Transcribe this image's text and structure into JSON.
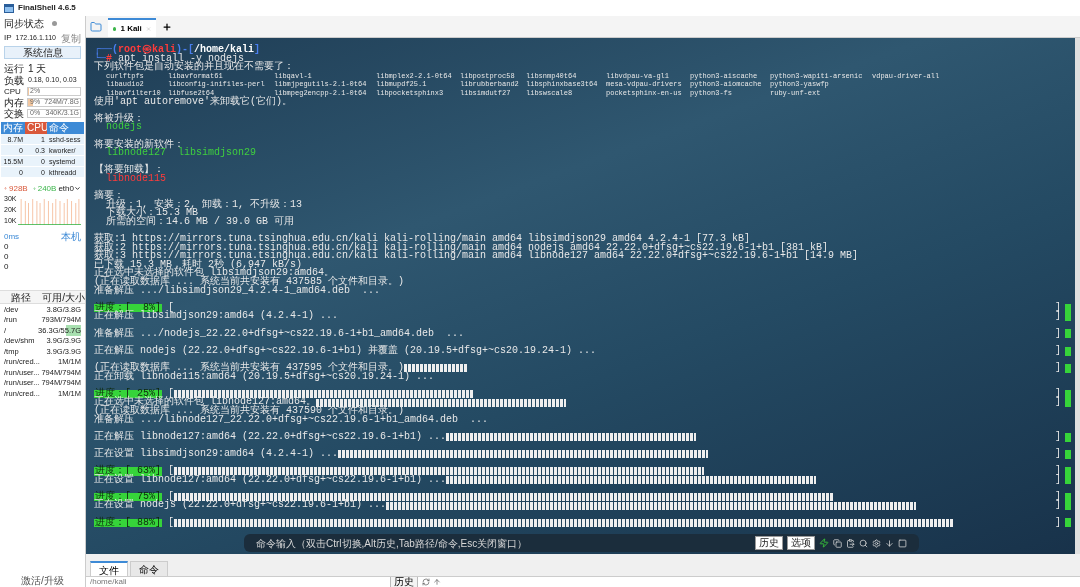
{
  "window": {
    "title": "FinalShell 4.6.5"
  },
  "sidebar": {
    "sync": {
      "label": "同步状态",
      "online": false
    },
    "ip": {
      "label": "IP",
      "value": "172.16.1.110",
      "action": "复制"
    },
    "sysinfo_button": "系统信息",
    "uptime": {
      "label": "运行",
      "value": "1 天"
    },
    "load": {
      "label": "负载",
      "value": "0.18, 0.10, 0.03"
    },
    "meters": [
      {
        "label": "CPU",
        "level": 0.02,
        "reading": "2%"
      },
      {
        "label": "内存",
        "level": 0.09,
        "reading": "9%",
        "detail": "724M/7.8G"
      },
      {
        "label": "交换",
        "reading": "0%",
        "detail": "340K/3.1G"
      }
    ],
    "processes": {
      "columns": [
        {
          "label": "内存",
          "selected": false
        },
        {
          "label": "CPU",
          "selected": true
        },
        {
          "label": "命令",
          "selected": false
        }
      ],
      "rows": [
        [
          "8.7M",
          "1",
          "sshd-sess"
        ],
        [
          "0",
          "0.3",
          "kworker/"
        ],
        [
          "15.5M",
          "0",
          "systemd"
        ],
        [
          "0",
          "0",
          "kthreadd"
        ]
      ]
    },
    "network": {
      "up": "928B",
      "down": "240B",
      "interface": "eth0",
      "yticks": [
        "30K",
        "20K",
        "10K"
      ]
    },
    "ping": {
      "latency": "0ms",
      "host": "本机",
      "values": [
        "0",
        "0",
        "0"
      ]
    },
    "disks": {
      "columns": [
        "路径",
        "可用/大小"
      ],
      "rows": [
        {
          "path": "/dev",
          "usage": "3.8G/3.8G"
        },
        {
          "path": "/run",
          "usage": "793M/794M"
        },
        {
          "path": "/",
          "usage": "36.3G/55.7G",
          "level": 0.35
        },
        {
          "path": "/dev/shm",
          "usage": "3.9G/3.9G"
        },
        {
          "path": "/tmp",
          "usage": "3.9G/3.9G"
        },
        {
          "path": "/run/cred...",
          "usage": "1M/1M"
        },
        {
          "path": "/run/user...",
          "usage": "794M/794M"
        },
        {
          "path": "/run/user...",
          "usage": "794M/794M"
        },
        {
          "path": "/run/cred...",
          "usage": "1M/1M"
        }
      ]
    },
    "upgrade_link": "激活/升级"
  },
  "tabs": [
    {
      "label": "1 Kali",
      "selected": true,
      "connected": true
    }
  ],
  "terminal": {
    "lines": [
      {
        "kind": "text",
        "segments": [
          {
            "text": "┌──(",
            "kind": "frame"
          },
          {
            "text": "root㉿kali",
            "kind": "user"
          },
          {
            "text": ")-[",
            "kind": "frame"
          },
          {
            "text": "/home/kali",
            "kind": "path"
          },
          {
            "text": "]",
            "kind": "frame"
          }
        ]
      },
      {
        "kind": "text",
        "segments": [
          {
            "text": "└─",
            "kind": "frame"
          },
          {
            "text": "#",
            "kind": "user"
          },
          {
            "text": " apt install -y nodejs",
            "kind": "plain"
          }
        ]
      },
      {
        "kind": "text",
        "segments": [
          {
            "text": "下列软件包是自动安装的并且现在不需要了：",
            "kind": "plain"
          }
        ]
      },
      {
        "kind": "packages",
        "cells": [
          "curlftpfs",
          "libavformat61",
          "libqavl-1",
          "libmplex2-2.1-0t64",
          "libpostproc58",
          "libsnmp40t64",
          "libvdpau-va-gl1",
          "python3-aiscache",
          "python3-wapiti-arsenic",
          "vdpau-driver-all"
        ]
      },
      {
        "kind": "packages",
        "cells": [
          "libaudio2",
          "libconfig-inifiles-perl",
          "libmjpegutils-2.1-0t64",
          "libmupdf25.1",
          "librubberband2",
          "libsphinxbase3t64",
          "mesa-vdpau-drivers",
          "python3-aiomcache",
          "python3-yaswfp"
        ]
      },
      {
        "kind": "packages",
        "cells": [
          "libavfilter10",
          "libfuse2t64",
          "libmpeg2encpp-2.1-0t64",
          "libpocketsphinx3",
          "libsimdutf27",
          "libswscale8",
          "pocketsphinx-en-us",
          "python3-fs",
          "ruby-unf-ext"
        ]
      },
      {
        "kind": "text",
        "segments": [
          {
            "text": "使用'apt autoremove'来卸载它(它们)。",
            "kind": "plain"
          }
        ]
      },
      {
        "kind": "blank"
      },
      {
        "kind": "text",
        "segments": [
          {
            "text": "将被升级：",
            "kind": "plain"
          }
        ]
      },
      {
        "kind": "text",
        "segments": [
          {
            "text": "  nodejs",
            "kind": "added"
          }
        ]
      },
      {
        "kind": "blank"
      },
      {
        "kind": "text",
        "segments": [
          {
            "text": "将要安装的新软件：",
            "kind": "plain"
          }
        ]
      },
      {
        "kind": "text",
        "segments": [
          {
            "text": "  libnode127  libsimdjson29",
            "kind": "added"
          }
        ]
      },
      {
        "kind": "blank"
      },
      {
        "kind": "text",
        "segments": [
          {
            "text": "【将要卸载】：",
            "kind": "plain"
          }
        ]
      },
      {
        "kind": "text",
        "segments": [
          {
            "text": "  libnode115",
            "kind": "removed"
          }
        ]
      },
      {
        "kind": "blank"
      },
      {
        "kind": "text",
        "segments": [
          {
            "text": "摘要：",
            "kind": "plain"
          }
        ]
      },
      {
        "kind": "text",
        "segments": [
          {
            "text": "  升级：1, 安装：2, 卸载：1, 不升级：13",
            "kind": "plain"
          }
        ]
      },
      {
        "kind": "text",
        "segments": [
          {
            "text": "  下载大小：15.3 MB",
            "kind": "plain"
          }
        ]
      },
      {
        "kind": "text",
        "segments": [
          {
            "text": "  所需的空间：14.6 MB / 39.0 GB 可用",
            "kind": "plain"
          }
        ]
      },
      {
        "kind": "blank"
      },
      {
        "kind": "text",
        "segments": [
          {
            "text": "获取:1 https://mirrors.tuna.tsinghua.edu.cn/kali kali-rolling/main amd64 libsimdjson29 amd64 4.2.4-1 [77.3 kB]",
            "kind": "plain"
          }
        ]
      },
      {
        "kind": "text",
        "segments": [
          {
            "text": "获取:2 https://mirrors.tuna.tsinghua.edu.cn/kali kali-rolling/main amd64 nodejs amd64 22.22.0+dfsg+~cs22.19.6-1+b1 [381 kB]",
            "kind": "plain"
          }
        ]
      },
      {
        "kind": "text",
        "segments": [
          {
            "text": "获取:3 https://mirrors.tuna.tsinghua.edu.cn/kali kali-rolling/main amd64 libnode127 amd64 22.22.0+dfsg+~cs22.19.6-1+b1 [14.9 MB]",
            "kind": "plain"
          }
        ]
      },
      {
        "kind": "text",
        "segments": [
          {
            "text": "已下载 15.3 MB，耗时 2秒 (6,947 kB/s)",
            "kind": "plain"
          }
        ]
      },
      {
        "kind": "text",
        "segments": [
          {
            "text": "正在选中未选择的软件包 libsimdjson29:amd64。",
            "kind": "plain"
          }
        ]
      },
      {
        "kind": "text",
        "segments": [
          {
            "text": "(正在读取数据库 ... 系统当前共安装有 437585 个文件和目录。)",
            "kind": "plain"
          }
        ]
      },
      {
        "kind": "text",
        "segments": [
          {
            "text": "准备解压 .../libsimdjson29_4.2.4-1_amd64.deb  ...",
            "kind": "plain"
          }
        ]
      },
      {
        "kind": "blank"
      },
      {
        "kind": "text",
        "segments": [
          {
            "text": "进度：[  8%]",
            "kind": "badge"
          },
          {
            "text": " [",
            "kind": "plain"
          }
        ],
        "tail": "]"
      },
      {
        "kind": "text",
        "segments": [
          {
            "text": "正在解压 libsimdjson29:amd64 (4.2.4-1) ...",
            "kind": "plain"
          }
        ],
        "tail": "]"
      },
      {
        "kind": "blank"
      },
      {
        "kind": "text",
        "segments": [
          {
            "text": "准备解压 .../nodejs_22.22.0+dfsg+~cs22.19.6-1+b1_amd64.deb  ...",
            "kind": "plain"
          }
        ],
        "tail": "]"
      },
      {
        "kind": "blank"
      },
      {
        "kind": "text",
        "segments": [
          {
            "text": "正在解压 nodejs (22.22.0+dfsg+~cs22.19.6-1+b1) 并覆盖 (20.19.5+dfsg+~cs20.19.24-1) ...",
            "kind": "plain"
          }
        ],
        "tail": "]"
      },
      {
        "kind": "blank"
      },
      {
        "kind": "text",
        "segments": [
          {
            "text": "(正在读取数据库 ... 系统当前共安装有 437595 个文件和目录。)",
            "kind": "plain"
          },
          {
            "kind": "tiny"
          }
        ],
        "tail": "]"
      },
      {
        "kind": "text",
        "segments": [
          {
            "text": "正在卸载 libnode115:amd64 (20.19.5+dfsg+~cs20.19.24-1) ...",
            "kind": "plain"
          }
        ]
      },
      {
        "kind": "blank"
      },
      {
        "kind": "text",
        "segments": [
          {
            "text": "进度：[ 25%]",
            "kind": "badge"
          },
          {
            "text": " [",
            "kind": "plain"
          },
          {
            "kind": "medium"
          }
        ],
        "tail": "]"
      },
      {
        "kind": "text",
        "segments": [
          {
            "text": "正在选中未选择的软件包 libnode127:amd64。",
            "kind": "plain"
          },
          {
            "kind": "short"
          }
        ],
        "tail": "]"
      },
      {
        "kind": "text",
        "segments": [
          {
            "text": "(正在读取数据库 ... 系统当前共安装有 437590 个文件和目录。)",
            "kind": "plain"
          }
        ]
      },
      {
        "kind": "text",
        "segments": [
          {
            "text": "准备解压 .../libnode127_22.22.0+dfsg+~cs22.19.6-1+b1_amd64.deb  ...",
            "kind": "plain"
          }
        ]
      },
      {
        "kind": "blank"
      },
      {
        "kind": "text",
        "segments": [
          {
            "text": "正在解压 libnode127:amd64 (22.22.0+dfsg+~cs22.19.6-1+b1) ...",
            "kind": "plain"
          },
          {
            "kind": "short"
          }
        ],
        "tail": "]"
      },
      {
        "kind": "blank"
      },
      {
        "kind": "text",
        "segments": [
          {
            "text": "正在设置 libsimdjson29:amd64 (4.2.4-1) ...",
            "kind": "plain"
          },
          {
            "kind": "long"
          }
        ],
        "tail": "]"
      },
      {
        "kind": "blank"
      },
      {
        "kind": "text",
        "segments": [
          {
            "text": "进度：[ 63%]",
            "kind": "badge"
          },
          {
            "text": " [",
            "kind": "plain"
          },
          {
            "kind": "wide"
          }
        ],
        "tail": "]"
      },
      {
        "kind": "text",
        "segments": [
          {
            "text": "正在设置 libnode127:amd64 (22.22.0+dfsg+~cs22.19.6-1+b1) ...",
            "kind": "plain"
          },
          {
            "kind": "long"
          }
        ],
        "tail": "]"
      },
      {
        "kind": "blank"
      },
      {
        "kind": "text",
        "segments": [
          {
            "text": "进度：[ 75%]",
            "kind": "badge"
          },
          {
            "text": " [",
            "kind": "plain"
          },
          {
            "kind": "wider"
          }
        ],
        "tail": "]"
      },
      {
        "kind": "text",
        "segments": [
          {
            "text": "正在设置 nodejs (22.22.0+dfsg+~cs22.19.6-1+b1) ...",
            "kind": "plain"
          },
          {
            "kind": "wide"
          }
        ],
        "tail": "]"
      },
      {
        "kind": "blank"
      },
      {
        "kind": "text",
        "segments": [
          {
            "text": "进度：[ 88%]",
            "kind": "badge"
          },
          {
            "text": " [",
            "kind": "plain"
          },
          {
            "kind": "full"
          }
        ],
        "tail": "]"
      }
    ]
  },
  "command_bar": {
    "placeholder": "命令输入（双击Ctrl切换,Alt历史,Tab路径/命令,Esc关闭窗口）",
    "buttons": [
      "历史",
      "选项"
    ]
  },
  "bottom_panel": {
    "tabs": [
      {
        "label": "文件",
        "selected": true
      },
      {
        "label": "命令",
        "selected": false
      }
    ],
    "path": "/home/kali",
    "history_button": "历史"
  }
}
